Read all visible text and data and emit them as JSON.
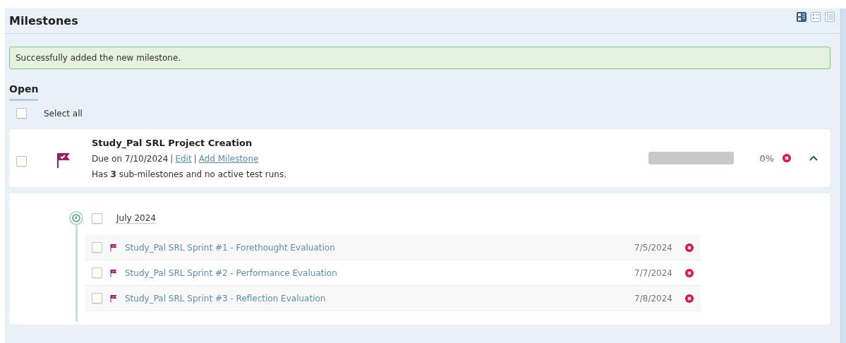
{
  "header": {
    "title": "Milestones",
    "view_modes": [
      {
        "selected": true
      },
      {
        "selected": false
      },
      {
        "selected": false
      }
    ]
  },
  "alert": {
    "message": "Successfully added the new milestone."
  },
  "section": {
    "title": "Open"
  },
  "select_all": {
    "label": "Select all",
    "checked": false
  },
  "milestone": {
    "title": "Study_Pal SRL Project Creation",
    "checked": false,
    "due": "Due on 7/10/2024",
    "links": [
      "Edit",
      "Add Milestone"
    ],
    "separators": [
      "|",
      "|"
    ],
    "summary": "Has **3** sub-milestones and no active test runs.",
    "level": 0,
    "percent": "0%",
    "expanded": true
  },
  "group": {
    "label": "July 2024",
    "checked": false,
    "items": [
      {
        "title": "Study_Pal SRL Sprint #1 - Forethought Evaluation",
        "date": "7/5/2024",
        "checked": false
      },
      {
        "title": "Study_Pal SRL Sprint #2 - Performance Evaluation",
        "date": "7/7/2024",
        "checked": false
      },
      {
        "title": "Study_Pal SRL Sprint #3 - Reflection Evaluation",
        "date": "7/8/2024",
        "checked": false
      }
    ]
  }
}
